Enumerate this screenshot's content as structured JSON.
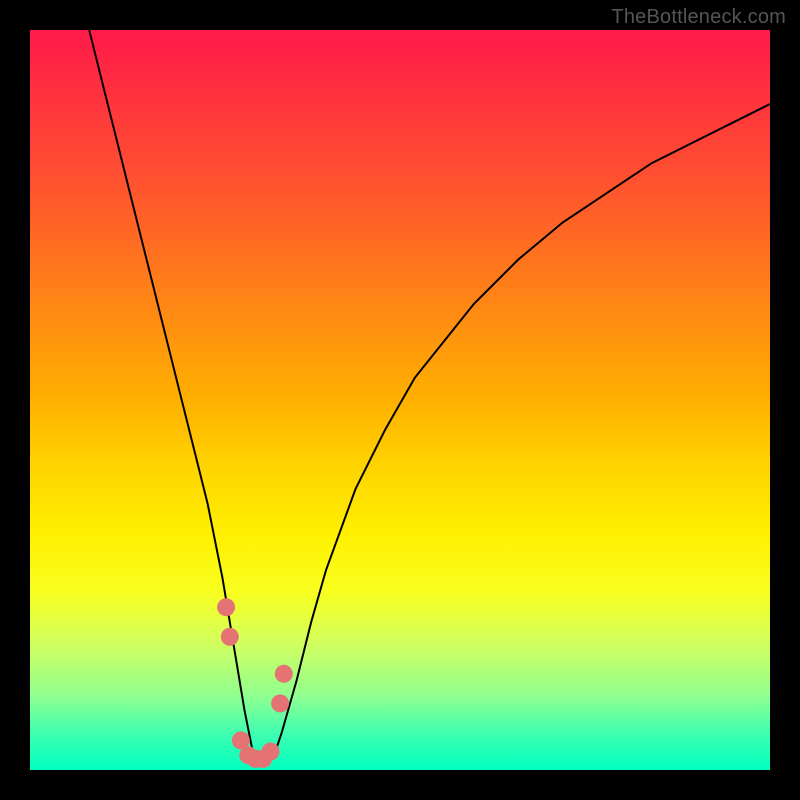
{
  "watermark": "TheBottleneck.com",
  "colors": {
    "frame": "#000000",
    "gradient_top": "#ff1a4a",
    "gradient_mid": "#fff000",
    "gradient_bottom": "#00ffc0",
    "curve": "#000000",
    "dots": "#e57373"
  },
  "chart_data": {
    "type": "line",
    "title": "",
    "xlabel": "",
    "ylabel": "",
    "xlim": [
      0,
      100
    ],
    "ylim": [
      0,
      100
    ],
    "grid": false,
    "series": [
      {
        "name": "bottleneck-curve",
        "x": [
          8,
          10,
          12,
          14,
          16,
          18,
          20,
          22,
          24,
          26,
          27,
          28,
          29,
          30,
          31,
          32,
          33,
          34,
          36,
          38,
          40,
          44,
          48,
          52,
          56,
          60,
          66,
          72,
          78,
          84,
          90,
          96,
          100
        ],
        "y": [
          100,
          92,
          84,
          76,
          68,
          60,
          52,
          44,
          36,
          26,
          20,
          14,
          8,
          3,
          1,
          1,
          2,
          5,
          12,
          20,
          27,
          38,
          46,
          53,
          58,
          63,
          69,
          74,
          78,
          82,
          85,
          88,
          90
        ]
      }
    ],
    "highlight_points": {
      "name": "valley-dots",
      "x": [
        26.5,
        27.0,
        28.5,
        29.5,
        30.5,
        31.5,
        32.5,
        33.8,
        34.3
      ],
      "y": [
        22,
        18,
        4,
        2,
        1.5,
        1.5,
        2.5,
        9,
        13
      ]
    }
  }
}
